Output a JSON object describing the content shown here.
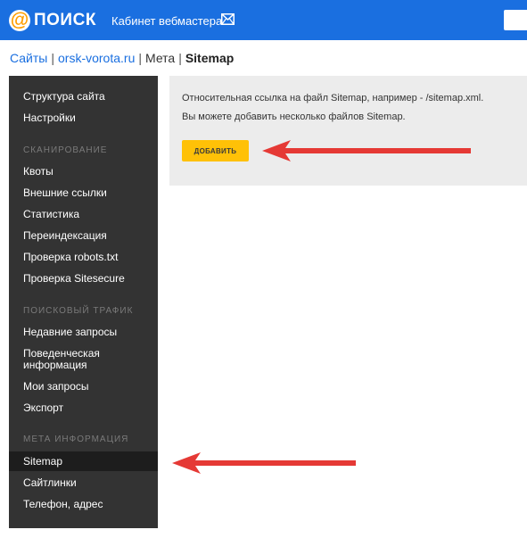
{
  "header": {
    "logo_symbol": "@",
    "logo_text": "ПОИСК",
    "cabinet_label": "Кабинет вебмастера",
    "bg_color": "#1a6fe0"
  },
  "breadcrumb": {
    "sites": "Сайты",
    "domain": "orsk-vorota.ru",
    "meta": "Мета",
    "current": "Sitemap",
    "separator": "|"
  },
  "sidebar": {
    "items": [
      {
        "label": "Структура сайта"
      },
      {
        "label": "Настройки"
      },
      {
        "section": "СКАНИРОВАНИЕ"
      },
      {
        "label": "Квоты"
      },
      {
        "label": "Внешние ссылки"
      },
      {
        "label": "Статистика"
      },
      {
        "label": "Переиндексация"
      },
      {
        "label": "Проверка robots.txt"
      },
      {
        "label": "Проверка Sitesecure"
      },
      {
        "section": "ПОИСКОВЫЙ ТРАФИК"
      },
      {
        "label": "Недавние запросы"
      },
      {
        "label": "Поведенческая информация"
      },
      {
        "label": "Мои запросы"
      },
      {
        "label": "Экспорт"
      },
      {
        "section": "МЕТА ИНФОРМАЦИЯ"
      },
      {
        "label": "Sitemap",
        "active": true
      },
      {
        "label": "Сайтлинки"
      },
      {
        "label": "Телефон, адрес"
      }
    ]
  },
  "panel": {
    "line1": "Относительная ссылка на файл Sitemap, например - /sitemap.xml.",
    "line2": "Вы можете добавить несколько файлов Sitemap.",
    "add_button": "ДОБАВИТЬ",
    "button_color": "#ffc107"
  },
  "annotations": {
    "arrow_color": "#e53935"
  }
}
